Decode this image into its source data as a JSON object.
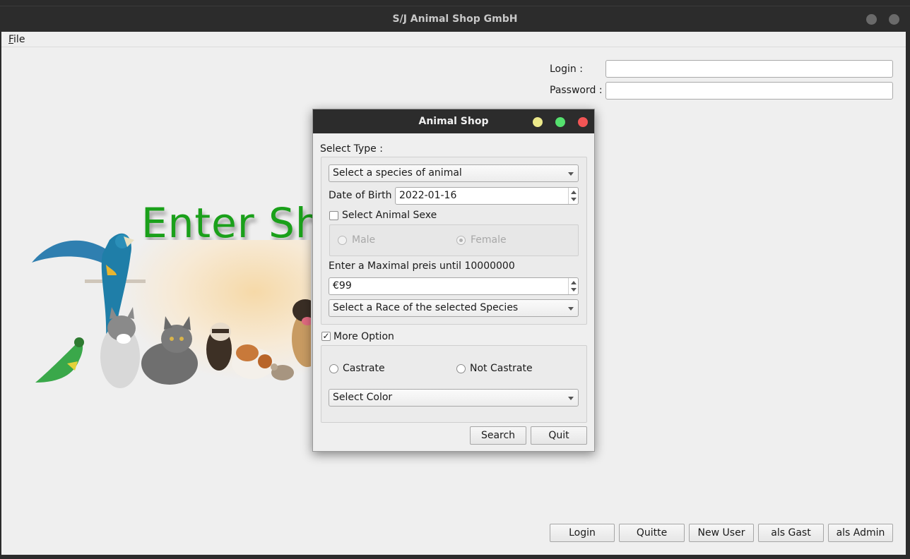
{
  "window": {
    "title": "S/J Animal Shop GmbH"
  },
  "menu": {
    "file": "File"
  },
  "login": {
    "login_label": "Login :",
    "password_label": "Password :",
    "login_value": "",
    "password_value": ""
  },
  "banner": {
    "heading": "Enter Shop"
  },
  "bottom_buttons": [
    "Login",
    "Quitte",
    "New User",
    "als Gast",
    "als Admin"
  ],
  "dialog": {
    "title": "Animal Shop",
    "select_type_label": "Select Type :",
    "species_combo": "Select a species of animal",
    "dob_label": "Date of Birth",
    "dob_value": "2022-01-16",
    "sexe_checkbox_label": "Select Animal Sexe",
    "sexe_checked": false,
    "male_label": "Male",
    "female_label": "Female",
    "female_selected": true,
    "price_label": "Enter a Maximal preis until 10000000",
    "price_value": "€99",
    "race_combo": "Select a Race of the selected Species",
    "more_option_label": "More Option",
    "more_option_checked": true,
    "castrate_label": "Castrate",
    "not_castrate_label": "Not Castrate",
    "color_combo": "Select Color",
    "search_button": "Search",
    "quit_button": "Quit"
  },
  "colors": {
    "titlebar": "#2c2c2c",
    "window_bg": "#efefef",
    "heading_green": "#1aa01a",
    "close_dot": "#f25555",
    "min_dot": "#f0e68c",
    "max_dot": "#55e06e"
  }
}
